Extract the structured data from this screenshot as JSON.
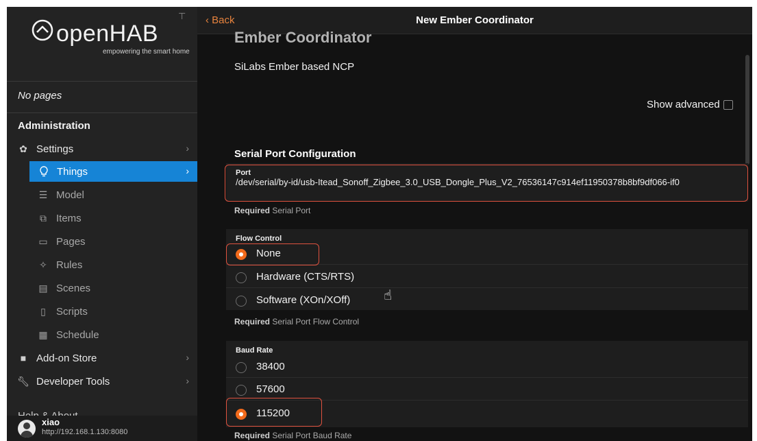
{
  "sidebar": {
    "logo": {
      "word": "openHAB",
      "tagline": "empowering the smart home"
    },
    "no_pages": "No pages",
    "section_title": "Administration",
    "items": [
      {
        "label": "Settings",
        "icon": "gear-icon"
      },
      {
        "label": "Things",
        "icon": "lightbulb-icon"
      },
      {
        "label": "Model",
        "icon": "list-icon"
      },
      {
        "label": "Items",
        "icon": "items-icon"
      },
      {
        "label": "Pages",
        "icon": "monitor-icon"
      },
      {
        "label": "Rules",
        "icon": "sparkle-icon"
      },
      {
        "label": "Scenes",
        "icon": "film-icon"
      },
      {
        "label": "Scripts",
        "icon": "document-icon"
      },
      {
        "label": "Schedule",
        "icon": "calendar-icon"
      },
      {
        "label": "Add-on Store",
        "icon": "bag-icon"
      },
      {
        "label": "Developer Tools",
        "icon": "wrench-icon"
      },
      {
        "label": "Help & About",
        "icon": "help-icon"
      }
    ],
    "user": {
      "name": "xiao",
      "url": "http://192.168.1.130:8080"
    }
  },
  "navbar": {
    "back": "Back",
    "title": "New Ember Coordinator"
  },
  "content": {
    "ghost_title": "Ember Coordinator",
    "description": "SiLabs Ember based NCP",
    "show_advanced": "Show advanced",
    "section_title": "Serial Port Configuration",
    "port": {
      "label": "Port",
      "value": "/dev/serial/by-id/usb-Itead_Sonoff_Zigbee_3.0_USB_Dongle_Plus_V2_76536147c914ef11950378b8bf9df066-if0",
      "hint_required": "Required",
      "hint_text": "Serial Port"
    },
    "flow_control": {
      "label": "Flow Control",
      "options": [
        "None",
        "Hardware (CTS/RTS)",
        "Software (XOn/XOff)"
      ],
      "selected": "None",
      "hint_required": "Required",
      "hint_text": "Serial Port Flow Control"
    },
    "baud_rate": {
      "label": "Baud Rate",
      "options": [
        "38400",
        "57600",
        "115200"
      ],
      "selected": "115200",
      "hint_required": "Required",
      "hint_text": "Serial Port Baud Rate"
    }
  },
  "colors": {
    "accent": "#1684d6",
    "radio_selected": "#f26a1b",
    "back_link": "#e7833e",
    "highlight": "#e0523f"
  }
}
